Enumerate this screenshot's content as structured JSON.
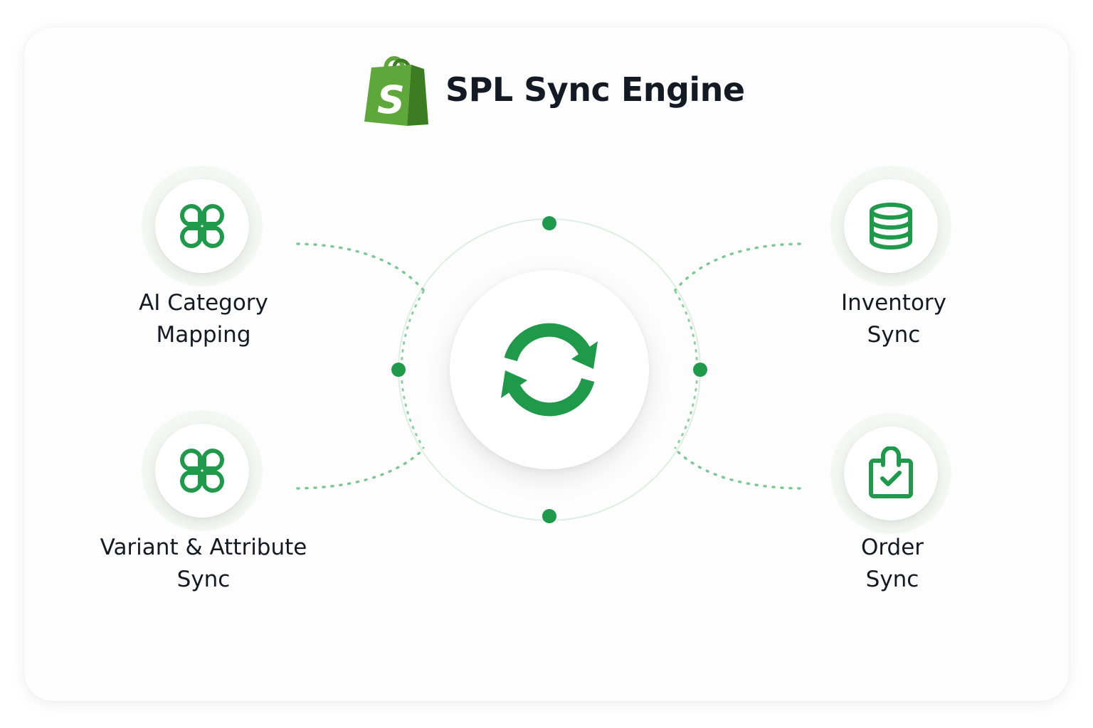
{
  "header": {
    "title": "SPL Sync Engine",
    "logo_icon": "shopify-bag-icon"
  },
  "hub": {
    "icon": "sync-arrows-icon"
  },
  "nodes": {
    "ai_category": {
      "line1": "AI Category",
      "line2": "Mapping",
      "icon": "clover-icon"
    },
    "variant": {
      "line1": "Variant & Attribute",
      "line2": "Sync",
      "icon": "clover-icon"
    },
    "inventory": {
      "line1": "Inventory",
      "line2": "Sync",
      "icon": "database-icon"
    },
    "order": {
      "line1": "Order",
      "line2": "Sync",
      "icon": "clipboard-check-icon"
    }
  },
  "colors": {
    "accent": "#1e9a4a",
    "accent_light": "#8fd0a3",
    "logo_green": "#5ea73a",
    "logo_dark": "#3c7d23",
    "text": "#141a24"
  }
}
